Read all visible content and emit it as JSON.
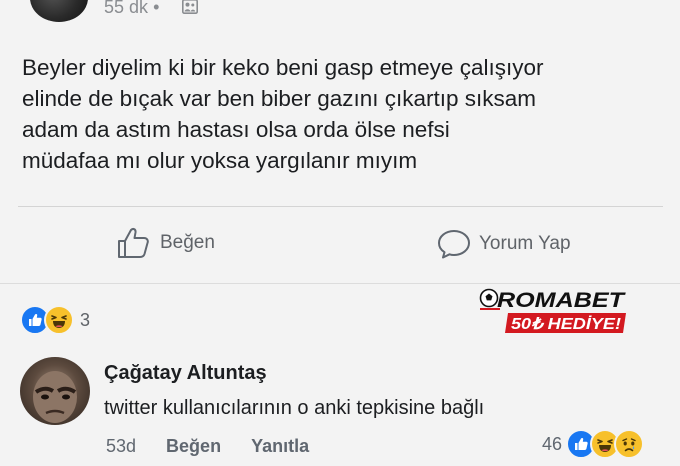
{
  "post": {
    "time": "55 dk",
    "time_separator": "•",
    "text_lines": [
      "Beyler diyelim ki bir keko beni gasp etmeye çalışıyor",
      "elinde de bıçak var ben biber gazını çıkartıp sıksam",
      "adam da astım hastası olsa orda ölse nefsi",
      "müdafaa mı olur yoksa yargılanır mıyım"
    ]
  },
  "actions": {
    "like_label": "Beğen",
    "comment_label": "Yorum Yap"
  },
  "reactions": {
    "types": [
      "like-icon",
      "haha-icon"
    ],
    "count": "3"
  },
  "ad": {
    "brand": "ROMABET",
    "offer": "50₺ HEDİYE!"
  },
  "comment": {
    "author": "Çağatay Altuntaş",
    "text": "twitter kullanıcılarının o anki tepkisine bağlı",
    "time": "53d",
    "like_label": "Beğen",
    "reply_label": "Yanıtla",
    "reaction_count": "46",
    "reaction_types": [
      "like-icon",
      "haha-icon",
      "sad-icon"
    ]
  },
  "colors": {
    "like_blue": "#1877f2",
    "reaction_yellow": "#f7c02b",
    "ad_red": "#d31920",
    "secondary_text": "#606770"
  }
}
